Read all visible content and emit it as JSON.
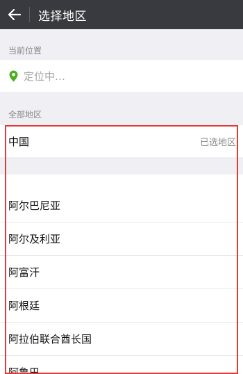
{
  "header": {
    "title": "选择地区",
    "back_icon": "arrow-left-icon"
  },
  "current_location": {
    "section_label": "当前位置",
    "icon": "location-pin-icon",
    "icon_color": "#4caf1f",
    "status_text": "定位中…"
  },
  "all_regions": {
    "section_label": "全部地区",
    "selected": {
      "name": "中国",
      "tag": "已选地区"
    },
    "countries": [
      {
        "name": "阿尔巴尼亚"
      },
      {
        "name": "阿尔及利亚"
      },
      {
        "name": "阿富汗"
      },
      {
        "name": "阿根廷"
      },
      {
        "name": "阿拉伯联合酋长国"
      },
      {
        "name": "阿鲁巴"
      }
    ]
  },
  "colors": {
    "header_bg": "#393a3f",
    "highlight_border": "#e53935",
    "page_bg": "#efeff4"
  }
}
